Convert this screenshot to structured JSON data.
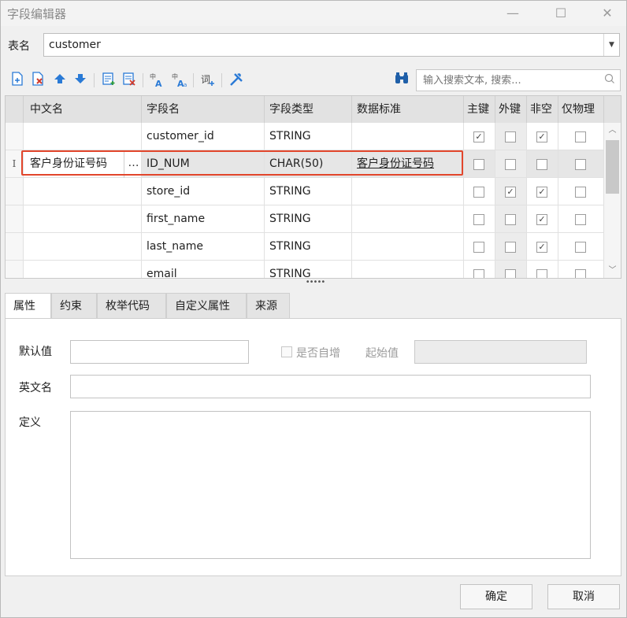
{
  "window": {
    "title": "字段编辑器",
    "controls": [
      "—",
      "☐",
      "✕"
    ]
  },
  "table_name": {
    "label": "表名",
    "value": "customer",
    "dropdown_glyph": "▼"
  },
  "toolbar": {
    "icons": [
      "add-field-icon",
      "delete-field-icon",
      "move-up-icon",
      "move-down-icon",
      "insert-row-icon",
      "remove-row-icon",
      "to-uppercase-icon",
      "to-lowercase-icon",
      "word-icon",
      "tools-icon",
      "binoculars-icon"
    ],
    "search_placeholder": "输入搜索文本, 搜索...",
    "search_icon_glyph": "○"
  },
  "grid": {
    "headers": [
      "中文名",
      "字段名",
      "字段类型",
      "数据标准",
      "主键",
      "外键",
      "非空",
      "仅物理"
    ],
    "rows": [
      {
        "indicator": "",
        "cn_name": "",
        "field_name": "customer_id",
        "field_type": "STRING",
        "standard": "",
        "pk": true,
        "fk": false,
        "notnull": true,
        "physical": false
      },
      {
        "indicator": "I",
        "cn_name": "客户身份证号码",
        "field_name": "ID_NUM",
        "field_type": "CHAR(50)",
        "standard": "客户身份证号码",
        "pk": false,
        "fk": false,
        "notnull": false,
        "physical": false,
        "editing": true
      },
      {
        "indicator": "",
        "cn_name": "",
        "field_name": "store_id",
        "field_type": "STRING",
        "standard": "",
        "pk": false,
        "fk": true,
        "notnull": true,
        "physical": false
      },
      {
        "indicator": "",
        "cn_name": "",
        "field_name": "first_name",
        "field_type": "STRING",
        "standard": "",
        "pk": false,
        "fk": false,
        "notnull": true,
        "physical": false
      },
      {
        "indicator": "",
        "cn_name": "",
        "field_name": "last_name",
        "field_type": "STRING",
        "standard": "",
        "pk": false,
        "fk": false,
        "notnull": true,
        "physical": false
      },
      {
        "indicator": "",
        "cn_name": "",
        "field_name": "email",
        "field_type": "STRING",
        "standard": "",
        "pk": false,
        "fk": false,
        "notnull": false,
        "physical": false
      }
    ],
    "ellipsis": "…",
    "check_glyph": "✓"
  },
  "tabs": [
    "属性",
    "约束",
    "枚举代码",
    "自定义属性",
    "来源"
  ],
  "properties": {
    "default_label": "默认值",
    "default_value": "",
    "autoinc_label": "是否自增",
    "start_label": "起始值",
    "start_value": "",
    "english_label": "英文名",
    "english_value": "",
    "definition_label": "定义",
    "definition_value": ""
  },
  "buttons": {
    "ok": "确定",
    "cancel": "取消"
  },
  "colors": {
    "highlight_border": "#e2462c",
    "toolbar_blue": "#2a7ad6",
    "toolbar_red": "#d23a2a"
  }
}
